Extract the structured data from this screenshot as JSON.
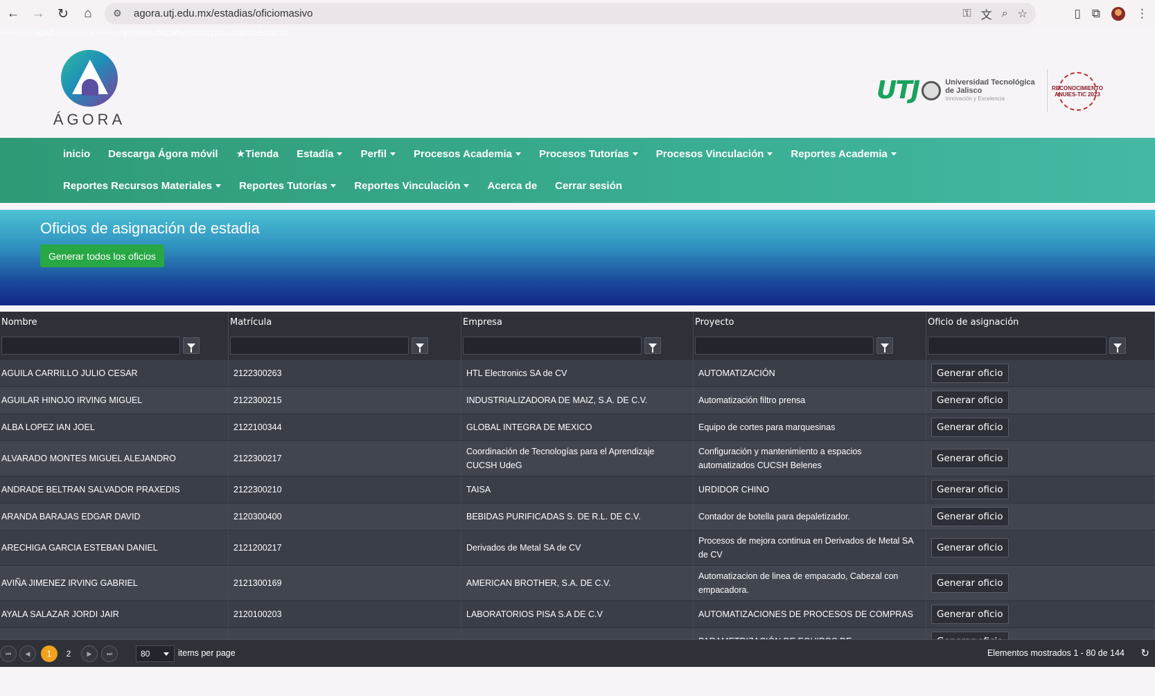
{
  "browser": {
    "url": "agora.utj.edu.mx/estadias/oficiomasivo",
    "back_icon": "←",
    "forward_icon": "→",
    "reload_icon": "↻",
    "home_icon": "⌂",
    "tune_icon": "⚙",
    "key_icon": "⚿",
    "translate_icon": "文",
    "zoom_icon": "⌕",
    "star_icon": "☆",
    "doc_icon": "▯",
    "ext_icon": "⧉",
    "menu_icon": "⋮"
  },
  "merge_text": "<<<<<<< HEAD ======= >>>>>>> b75ebeba9513f7c57864818caaa48030dfaba748",
  "header": {
    "agora_wordmark": "ÁGORA",
    "utj_mark": "UTJ",
    "utj_line1": "Universidad Tecnológica",
    "utj_line2": "de Jalisco",
    "utj_line3": "Innovación y Excelencia",
    "anuies": "RECONOCIMIENTO ANUIES-TIC 2023"
  },
  "nav": {
    "row1": [
      {
        "label": "inicio",
        "dropdown": false
      },
      {
        "label": "Descarga Ágora móvil",
        "dropdown": false
      },
      {
        "label": "★Tienda",
        "dropdown": false
      },
      {
        "label": "Estadía",
        "dropdown": true
      },
      {
        "label": "Perfil",
        "dropdown": true
      },
      {
        "label": "Procesos Academia",
        "dropdown": true
      },
      {
        "label": "Procesos Tutorías",
        "dropdown": true
      },
      {
        "label": "Procesos Vinculación",
        "dropdown": true
      },
      {
        "label": "Reportes Academia",
        "dropdown": true
      }
    ],
    "row2": [
      {
        "label": "Reportes Recursos Materiales",
        "dropdown": true
      },
      {
        "label": "Reportes Tutorías",
        "dropdown": true
      },
      {
        "label": "Reportes Vinculación",
        "dropdown": true
      },
      {
        "label": "Acerca de",
        "dropdown": false
      },
      {
        "label": "Cerrar sesión",
        "dropdown": false
      }
    ]
  },
  "banner": {
    "title": "Oficios de asignación de estadia",
    "generate_all_label": "Generar todos los oficios"
  },
  "grid": {
    "columns": [
      "Nombre",
      "Matrícula",
      "Empresa",
      "Proyecto",
      "Oficio de asignación"
    ],
    "button_label": "Generar oficio",
    "rows": [
      {
        "nombre": "AGUILA CARRILLO JULIO CESAR",
        "matricula": "2122300263",
        "empresa": [
          "HTL Electronics SA de CV"
        ],
        "proyecto": [
          "AUTOMATIZACIÓN"
        ]
      },
      {
        "nombre": "AGUILAR HINOJO IRVING MIGUEL",
        "matricula": "2122300215",
        "empresa": [
          "INDUSTRIALIZADORA DE MAIZ, S.A. DE C.V."
        ],
        "proyecto": [
          "Automatización filtro prensa"
        ]
      },
      {
        "nombre": "ALBA LOPEZ IAN JOEL",
        "matricula": "2122100344",
        "empresa": [
          "GLOBAL INTEGRA DE MEXICO"
        ],
        "proyecto": [
          "Equipo de cortes para marquesinas"
        ]
      },
      {
        "nombre": "ALVARADO MONTES MIGUEL ALEJANDRO",
        "matricula": "2122300217",
        "empresa": [
          "Coordinación de Tecnologías para el Aprendizaje",
          "CUCSH UdeG"
        ],
        "proyecto": [
          "Configuración y mantenimiento a espacios",
          "automatizados CUCSH Belenes"
        ]
      },
      {
        "nombre": "ANDRADE BELTRAN SALVADOR PRAXEDIS",
        "matricula": "2122300210",
        "empresa": [
          "TAISA"
        ],
        "proyecto": [
          "URDIDOR CHINO"
        ]
      },
      {
        "nombre": "ARANDA BARAJAS EDGAR DAVID",
        "matricula": "2120300400",
        "empresa": [
          "BEBIDAS PURIFICADAS S. DE R.L. DE C.V."
        ],
        "proyecto": [
          "Contador de botella para depaletizador."
        ]
      },
      {
        "nombre": "ARECHIGA GARCIA ESTEBAN DANIEL",
        "matricula": "2121200217",
        "empresa": [
          "Derivados de Metal SA de CV"
        ],
        "proyecto": [
          "Procesos de mejora continua en Derivados de Metal SA",
          "de CV"
        ]
      },
      {
        "nombre": "AVIÑA JIMENEZ IRVING GABRIEL",
        "matricula": "2121300169",
        "empresa": [
          "AMERICAN BROTHER, S.A. DE C.V."
        ],
        "proyecto": [
          "Automatizacion de linea de empacado, Cabezal con",
          "empacadora."
        ]
      },
      {
        "nombre": "AYALA SALAZAR JORDI JAIR",
        "matricula": "2120100203",
        "empresa": [
          "LABORATORIOS PISA S.A DE C.V"
        ],
        "proyecto": [
          "AUTOMATIZACIONES DE PROCESOS DE COMPRAS"
        ]
      },
      {
        "nombre": "",
        "matricula": "",
        "empresa": [
          ""
        ],
        "proyecto": [
          "PARAMETRIZACIÓN DE EQUIPOS DE"
        ]
      }
    ]
  },
  "pager": {
    "first_icon": "⏮",
    "prev_icon": "◀",
    "next_icon": "▶",
    "last_icon": "⏭",
    "pages": [
      "1",
      "2"
    ],
    "per_page": "80",
    "per_page_label": "items per page",
    "info": "Elementos mostrados 1 - 80 de 144",
    "refresh_icon": "↻"
  }
}
